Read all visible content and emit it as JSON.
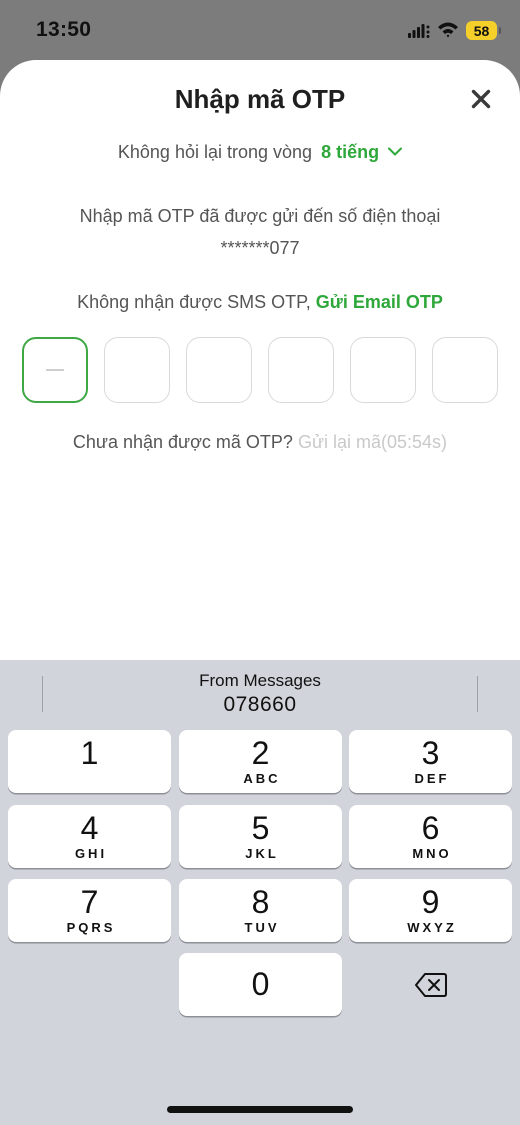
{
  "status_bar": {
    "time": "13:50",
    "battery": "58",
    "icons": [
      "signal-icon",
      "wifi-icon",
      "battery-icon"
    ]
  },
  "sheet": {
    "title": "Nhập mã OTP",
    "close_icon": "close-icon",
    "remember_label": "Không hỏi lại trong vòng",
    "remember_value": "8 tiếng",
    "description_line1": "Nhập mã OTP đã được gửi đến số điện thoại",
    "phone_masked": "*******077",
    "no_sms_label": "Không nhận được SMS OTP,",
    "email_otp_link": "Gửi Email OTP",
    "otp_boxes": [
      "",
      "",
      "",
      "",
      "",
      ""
    ],
    "resend_label": "Chưa nhận được mã OTP?",
    "resend_link": "Gửi lại mã",
    "resend_timer": "(05:54s)"
  },
  "keyboard": {
    "suggestion_source": "From Messages",
    "suggestion_code": "078660",
    "keys": [
      {
        "digit": "1",
        "letters": ""
      },
      {
        "digit": "2",
        "letters": "ABC"
      },
      {
        "digit": "3",
        "letters": "DEF"
      },
      {
        "digit": "4",
        "letters": "GHI"
      },
      {
        "digit": "5",
        "letters": "JKL"
      },
      {
        "digit": "6",
        "letters": "MNO"
      },
      {
        "digit": "7",
        "letters": "PQRS"
      },
      {
        "digit": "8",
        "letters": "TUV"
      },
      {
        "digit": "9",
        "letters": "WXYZ"
      },
      {
        "digit": "0",
        "letters": ""
      }
    ],
    "backspace_icon": "backspace-icon"
  },
  "colors": {
    "accent_green": "#2ea83a",
    "active_border": "#3ea845",
    "keyboard_bg": "#d1d4da",
    "dim_background": "#7c7c7c"
  }
}
